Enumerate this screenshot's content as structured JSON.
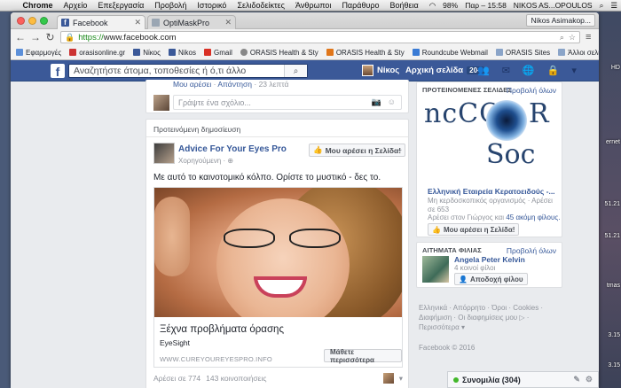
{
  "menubar": {
    "app": "Chrome",
    "items": [
      "Αρχείο",
      "Επεξεργασία",
      "Προβολή",
      "Ιστορικό",
      "Σελιδοδείκτες",
      "Άνθρωποι",
      "Παράθυρο",
      "Βοήθεια"
    ],
    "battery": "98%",
    "clock": "Παρ – 15:58",
    "user": "NIKOS AS...OPOULOS"
  },
  "desktop": {
    "labels": [
      "HD",
      "ernet",
      "51.21",
      "51.21",
      "tmas",
      "3.15",
      "3.15"
    ]
  },
  "tabs": [
    {
      "label": "Facebook",
      "active": true
    },
    {
      "label": "OptiMaskPro",
      "active": false
    }
  ],
  "profile_button": "Nikos Asimakop...",
  "omnibox": {
    "scheme": "https://",
    "host": "www.facebook.com"
  },
  "bookmarks": {
    "items": [
      "Εφαρμογές",
      "orasisonline.gr",
      "Νίκος",
      "Nikos",
      "Gmail",
      "ORASIS Health & Sty",
      "ORASIS Health & Sty",
      "Roundcube Webmail",
      "ORASIS Sites"
    ],
    "other": "Άλλοι σελιδοδείκτες"
  },
  "fb": {
    "logo": "f",
    "search_placeholder": "Αναζητήστε άτομα, τοποθεσίες ή ό,τι άλλο",
    "user_name": "Νίκος",
    "home_label": "Αρχική σελίδα",
    "home_count": "20+"
  },
  "reply": {
    "like_link": "Μου αρέσει",
    "reply_link": "Απάντηση",
    "time": "23 λεπτά",
    "comment_placeholder": "Γράψτε ένα σχόλιο..."
  },
  "post": {
    "sponsored_header": "Προτεινόμενη δημοσίευση",
    "page_name": "Advice For Your Eyes Pro",
    "sub": "Χορηγούμενη",
    "like_page_button": "Μου αρέσει η Σελίδα!",
    "text": "Με αυτό το καινοτομικό κόλπο. Ορίστε το μυστικό - δες το.",
    "ad_title": "Ξέχνα προβλήματα όρασης",
    "ad_site": "EyeSight",
    "ad_url": "WWW.CUREYOUREYESPRO.INFO",
    "learn_more": "Μάθετε περισσότερα",
    "likes": "Αρέσει σε 774",
    "shares": "143 κοινοποιήσεις"
  },
  "suggested": {
    "heading": "ΠΡΟΤΕΙΝΟΜΕΝΕΣ ΣΕΛΙΔΕΣ",
    "see_all": "Προβολή όλων",
    "img_text_1": "ncCO",
    "img_text_2": "Soc",
    "img_text_3": "R",
    "page_name": "Ελληνική Εταιρεία Κερατοειδούς -...",
    "desc": "Μη κερδοσκοπικός οργανισμός · Αρέσει σε 653",
    "likes_prefix": "Αρέσει στον Γιώργος και",
    "likes_link": "45 ακόμη φίλους.",
    "like_button": "Μου αρέσει η Σελίδα!"
  },
  "friends": {
    "heading": "ΑΙΤΗΜΑΤΑ ΦΙΛΙΑΣ",
    "see_all": "Προβολή όλων",
    "name": "Angela Peter Kelvin",
    "mutual": "4 κοινοί φίλοι",
    "accept": "Αποδοχή φίλου"
  },
  "footer": {
    "links": "Ελληνικά · Απόρρητο · Όροι · Cookies · Διαφήμιση · Οι διαφημίσεις μου ▷ · Περισσότερα ▾",
    "copyright": "Facebook © 2016"
  },
  "chat": {
    "label": "Συνομιλία (304)"
  }
}
